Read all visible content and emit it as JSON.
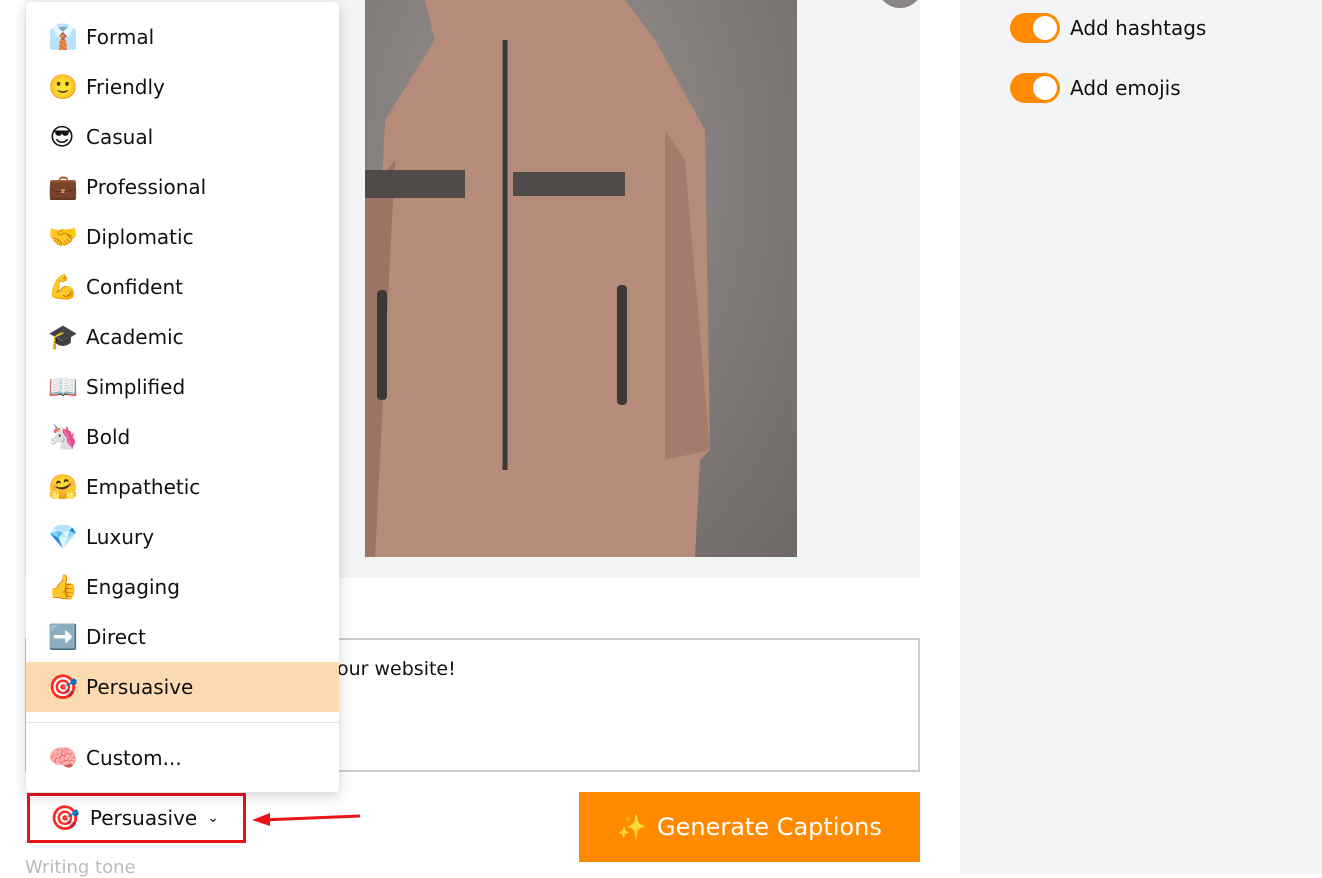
{
  "settings": {
    "hashtags_label": "Add hashtags",
    "hashtags_on": true,
    "emojis_label": "Add emojis",
    "emojis_on": true
  },
  "caption": {
    "visible_text": "our website!"
  },
  "generate": {
    "label": "Generate Captions",
    "icon": "✨"
  },
  "tone": {
    "selected": "Persuasive",
    "selected_icon": "🎯",
    "label": "Writing tone"
  },
  "menu": {
    "items": [
      {
        "icon": "👔",
        "label": "Formal"
      },
      {
        "icon": "🙂",
        "label": "Friendly"
      },
      {
        "icon": "😎",
        "label": "Casual"
      },
      {
        "icon": "💼",
        "label": "Professional"
      },
      {
        "icon": "🤝",
        "label": "Diplomatic"
      },
      {
        "icon": "💪",
        "label": "Confident"
      },
      {
        "icon": "🎓",
        "label": "Academic"
      },
      {
        "icon": "📖",
        "label": "Simplified"
      },
      {
        "icon": "🦄",
        "label": "Bold"
      },
      {
        "icon": "🤗",
        "label": "Empathetic"
      },
      {
        "icon": "💎",
        "label": "Luxury"
      },
      {
        "icon": "👍",
        "label": "Engaging"
      },
      {
        "icon": "➡️",
        "label": "Direct"
      },
      {
        "icon": "🎯",
        "label": "Persuasive"
      }
    ],
    "custom": {
      "icon": "🧠",
      "label": "Custom..."
    }
  },
  "colors": {
    "accent": "#ff8a00",
    "highlight": "#fddbb0",
    "annotation": "#e8141a"
  }
}
